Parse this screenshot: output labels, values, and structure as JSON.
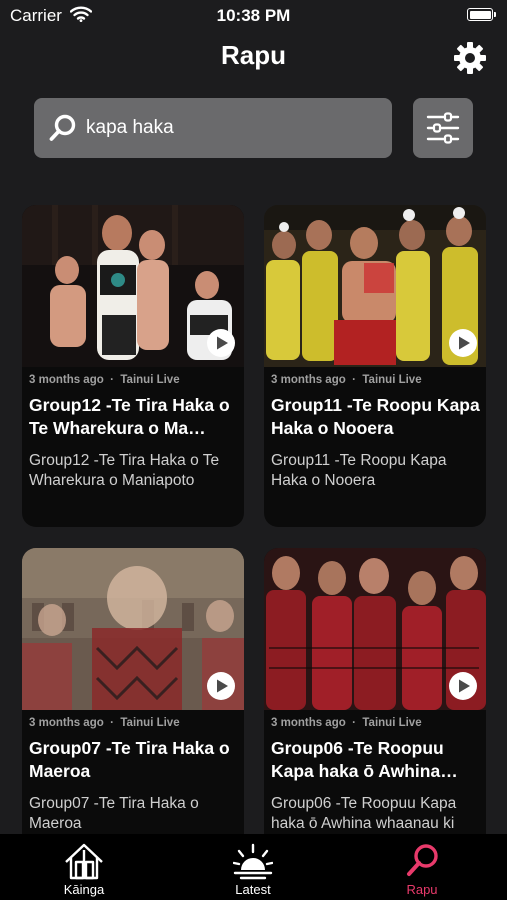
{
  "status_bar": {
    "carrier": "Carrier",
    "time": "10:38 PM",
    "wifi_icon": "wifi-icon",
    "battery_icon": "battery-icon"
  },
  "header": {
    "title": "Rapu",
    "settings_icon": "gear-icon"
  },
  "search": {
    "value": "kapa haka",
    "icon": "search-icon",
    "filter_icon": "sliders-icon"
  },
  "results": [
    {
      "meta_age": "3 months ago",
      "meta_channel": "Tainui Live",
      "title": "Group12 -Te Tira Haka o Te Wharekura o Ma…",
      "description": "Group12 -Te Tira Haka o Te Wharekura o Maniapoto"
    },
    {
      "meta_age": "3 months ago",
      "meta_channel": "Tainui Live",
      "title": "Group11 -Te Roopu Kapa Haka o Nooera",
      "description": "Group11 -Te Roopu Kapa Haka o Nooera"
    },
    {
      "meta_age": "3 months ago",
      "meta_channel": "Tainui Live",
      "title": "Group07 -Te Tira Haka o Maeroa",
      "description": "Group07 -Te Tira Haka o Maeroa"
    },
    {
      "meta_age": "3 months ago",
      "meta_channel": "Tainui Live",
      "title": "Group06 -Te Roopuu Kapa haka ō Awhina…",
      "description": "Group06 -Te Roopuu Kapa haka ō Awhina whaanau ki"
    }
  ],
  "meta_separator": "·",
  "tab_bar": {
    "tabs": [
      {
        "label": "Kāinga",
        "icon": "house-icon"
      },
      {
        "label": "Latest",
        "icon": "sunrise-icon"
      },
      {
        "label": "Rapu",
        "icon": "search-icon"
      }
    ],
    "active_color": "#e83a6b"
  },
  "colors": {
    "background": "#1c1c1e",
    "card": "#0b0b0b",
    "search_field": "#6a6a6c",
    "accent": "#e83a6b"
  }
}
